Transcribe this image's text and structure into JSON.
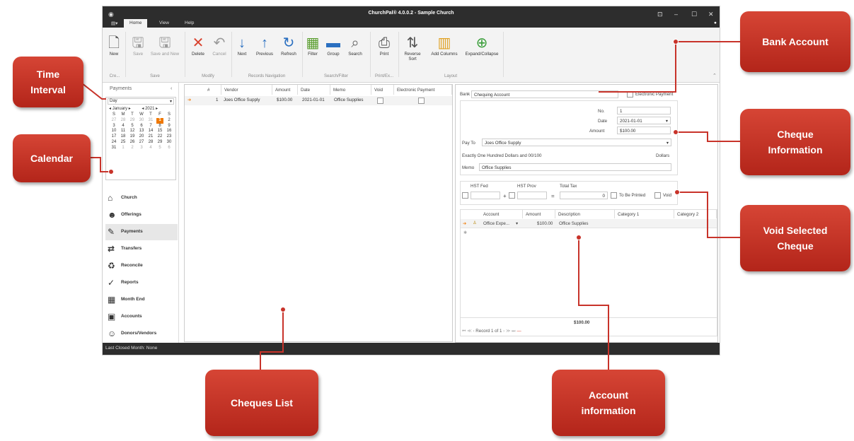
{
  "window": {
    "title": "ChurchPal® 4.0.0.2 - Sample Church"
  },
  "menu": {
    "tabs": [
      "Home",
      "View",
      "Help"
    ]
  },
  "ribbon": {
    "buttons": [
      "New",
      "Save",
      "Save and New",
      "Delete",
      "Cancel",
      "Next",
      "Previous",
      "Refresh",
      "Filter",
      "Group",
      "Search",
      "Print",
      "Reverse Sort",
      "Add Columns",
      "Expand/Collapse"
    ],
    "groups": [
      "Cre...",
      "Save",
      "Modify",
      "Records Navigation",
      "Search/Filter",
      "Print/Ex...",
      "Layout"
    ]
  },
  "left": {
    "header": "Payments",
    "collapse": "‹",
    "interval": "Day",
    "month": "January",
    "year": "2021",
    "weekdays": [
      "S",
      "M",
      "T",
      "W",
      "T",
      "F",
      "S"
    ],
    "weeks": [
      [
        "27",
        "28",
        "29",
        "30",
        "31",
        "1",
        "2"
      ],
      [
        "3",
        "4",
        "5",
        "6",
        "7",
        "8",
        "9"
      ],
      [
        "10",
        "11",
        "12",
        "13",
        "14",
        "15",
        "16"
      ],
      [
        "17",
        "18",
        "19",
        "20",
        "21",
        "22",
        "23"
      ],
      [
        "24",
        "25",
        "26",
        "27",
        "28",
        "29",
        "30"
      ],
      [
        "31",
        "1",
        "2",
        "3",
        "4",
        "5",
        "6"
      ]
    ],
    "nav": [
      "Church",
      "Offerings",
      "Payments",
      "Transfers",
      "Reconcile",
      "Reports",
      "Month End",
      "Accounts",
      "Donors/Vendors"
    ]
  },
  "grid": {
    "columns": [
      "#",
      "Vendor",
      "Amount",
      "Date",
      "Memo",
      "Void",
      "Electronic Payment"
    ],
    "rows": [
      {
        "num": "1",
        "vendor": "Joes Office Supply",
        "amount": "$100.00",
        "date": "2021-01-01",
        "memo": "Office Supplies"
      }
    ]
  },
  "cheque": {
    "bank_label": "Bank",
    "bank": "Chequing Account",
    "electronic": "Electronic Payment",
    "no_label": "No.",
    "no": "1",
    "date_label": "Date",
    "date": "2021-01-01",
    "amount_label": "Amount",
    "amount": "$100.00",
    "payto_label": "Pay To",
    "payto": "Joes Office Supply",
    "words": "Exactly One Hundred Dollars and 00/100",
    "dollars": "Dollars",
    "memo_label": "Memo",
    "memo": "Office Supplies",
    "hst_fed": "HST Fed",
    "hst_prov": "HST Prov",
    "total_tax": "Total Tax",
    "tax_value": "0",
    "plus": "+",
    "equals": "=",
    "to_be_printed": "To Be Printed",
    "void": "Void",
    "acc_columns": [
      "Account",
      "Amount",
      "Description",
      "Category 1",
      "Category 2"
    ],
    "acc_row": {
      "account": "Office Expe...",
      "amount": "$100.00",
      "description": "Office Supplies"
    },
    "total": "$100.00",
    "record": "Record 1 of 1"
  },
  "status": {
    "text": "Last Closed Month: None"
  },
  "callouts": {
    "bank_account": "Bank Account",
    "time_interval": "Time\nInterval",
    "calendar": "Calendar",
    "cheque_information": "Cheque\nInformation",
    "void_selected": "Void Selected\nCheque",
    "cheques_list": "Cheques List",
    "account_information": "Account\ninformation"
  },
  "colors": {
    "callout": "#c8332a",
    "accent": "#f07800",
    "titlebar": "#2d2d2d"
  }
}
